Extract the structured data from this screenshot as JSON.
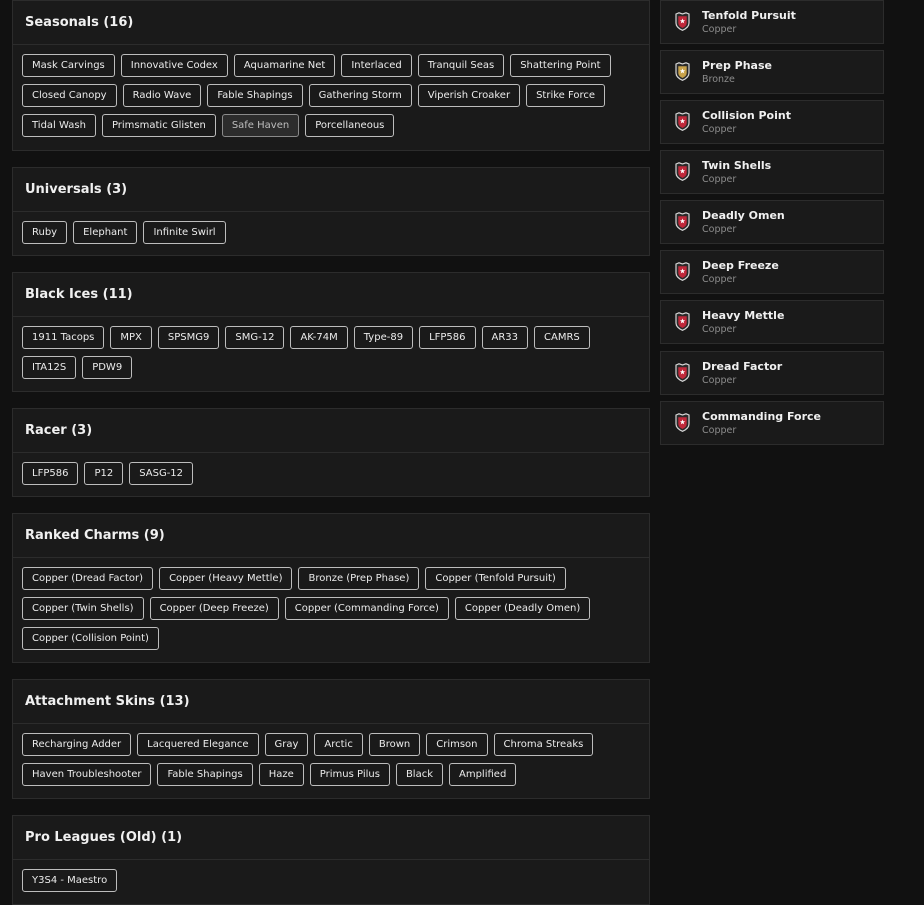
{
  "sections": [
    {
      "title": "Seasonals (16)",
      "items": [
        "Mask Carvings",
        "Innovative Codex",
        "Aquamarine Net",
        "Interlaced",
        "Tranquil Seas",
        "Shattering Point",
        "Closed Canopy",
        "Radio Wave",
        "Fable Shapings",
        "Gathering Storm",
        "Viperish Croaker",
        "Strike Force",
        "Tidal Wash",
        "Primsmatic Glisten",
        "Safe Haven",
        "Porcellaneous"
      ],
      "active_item": "Safe Haven"
    },
    {
      "title": "Universals (3)",
      "items": [
        "Ruby",
        "Elephant",
        "Infinite Swirl"
      ]
    },
    {
      "title": "Black Ices (11)",
      "items": [
        "1911 Tacops",
        "MPX",
        "SPSMG9",
        "SMG-12",
        "AK-74M",
        "Type-89",
        "LFP586",
        "AR33",
        "CAMRS",
        "ITA12S",
        "PDW9"
      ]
    },
    {
      "title": "Racer (3)",
      "items": [
        "LFP586",
        "P12",
        "SASG-12"
      ]
    },
    {
      "title": "Ranked Charms (9)",
      "items": [
        "Copper (Dread Factor)",
        "Copper (Heavy Mettle)",
        "Bronze (Prep Phase)",
        "Copper (Tenfold Pursuit)",
        "Copper (Twin Shells)",
        "Copper (Deep Freeze)",
        "Copper (Commanding Force)",
        "Copper (Deadly Omen)",
        "Copper (Collision Point)"
      ]
    },
    {
      "title": "Attachment Skins (13)",
      "items": [
        "Recharging Adder",
        "Lacquered Elegance",
        "Gray",
        "Arctic",
        "Brown",
        "Crimson",
        "Chroma Streaks",
        "Haven Troubleshooter",
        "Fable Shapings",
        "Haze",
        "Primus Pilus",
        "Black",
        "Amplified"
      ]
    },
    {
      "title": "Pro Leagues (Old) (1)",
      "items": [
        "Y3S4 - Maestro"
      ]
    }
  ],
  "charms": [
    {
      "name": "Tenfold Pursuit",
      "tier": "Copper",
      "icon": "copper-charm-icon"
    },
    {
      "name": "Prep Phase",
      "tier": "Bronze",
      "icon": "bronze-charm-icon"
    },
    {
      "name": "Collision Point",
      "tier": "Copper",
      "icon": "copper-charm-icon"
    },
    {
      "name": "Twin Shells",
      "tier": "Copper",
      "icon": "copper-charm-icon"
    },
    {
      "name": "Deadly Omen",
      "tier": "Copper",
      "icon": "copper-charm-icon"
    },
    {
      "name": "Deep Freeze",
      "tier": "Copper",
      "icon": "copper-charm-icon"
    },
    {
      "name": "Heavy Mettle",
      "tier": "Copper",
      "icon": "copper-charm-icon"
    },
    {
      "name": "Dread Factor",
      "tier": "Copper",
      "icon": "copper-charm-icon"
    },
    {
      "name": "Commanding Force",
      "tier": "Copper",
      "icon": "copper-charm-icon"
    }
  ],
  "colors": {
    "copper": "#c0283a",
    "bronze": "#c8a24a"
  }
}
